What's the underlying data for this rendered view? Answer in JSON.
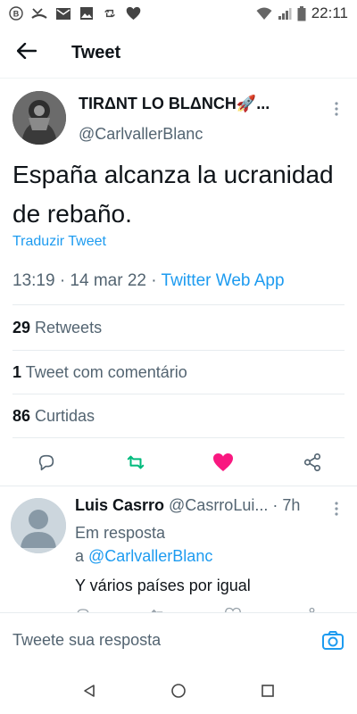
{
  "status_bar": {
    "time": "22:11",
    "icons_left": [
      "notification-b-icon",
      "missed-call-icon",
      "mail-icon",
      "image-icon",
      "retweet-notification-icon",
      "heart-notification-icon"
    ],
    "icons_right": [
      "wifi-icon",
      "signal-icon",
      "battery-icon"
    ]
  },
  "header": {
    "title": "Tweet"
  },
  "tweet": {
    "author_name": "TIRΔNT LO BLΔNCH🚀...",
    "author_handle": "@CarlvallerBlanc",
    "text": "España alcanza la ucranidad de rebaño.",
    "translate_label": "Traduzir Tweet",
    "time": "13:19 · 14 mar 22 · ",
    "source": "Twitter Web App"
  },
  "stats": {
    "retweets_count": "29",
    "retweets_label": " Retweets",
    "quotes_count": "1",
    "quotes_label": " Tweet com comentário",
    "likes_count": "86",
    "likes_label": " Curtidas"
  },
  "colors": {
    "accent": "#1d9bf0",
    "retweet_green": "#00ba7c",
    "like_pink": "#f91880"
  },
  "reply": {
    "name": "Luis Casrro",
    "handle": " @CasrroLui... · 7h",
    "context_prefix": "Em resposta",
    "context_a": "a ",
    "context_mention": "@CarlvallerBlanc",
    "text": "Y vários países por igual"
  },
  "compose": {
    "placeholder": "Tweete sua resposta"
  }
}
